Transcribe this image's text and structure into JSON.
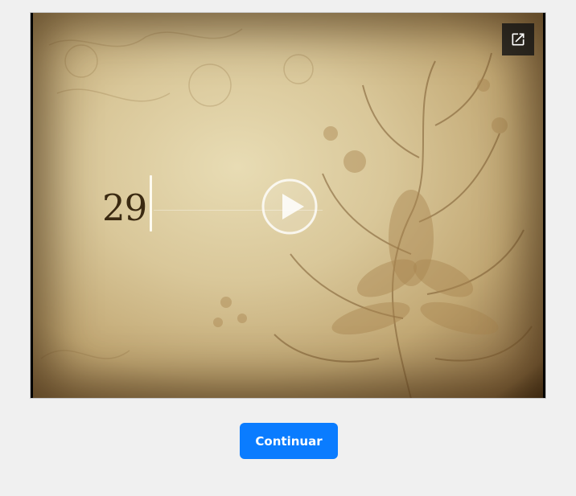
{
  "video": {
    "overlay_number": "29",
    "play_icon": "play-icon",
    "open_external_icon": "open-in-new-icon"
  },
  "actions": {
    "continue_label": "Continuar"
  },
  "colors": {
    "primary_button": "#0a7cff",
    "page_background": "#f0f0f0",
    "overlay_button": "#141414"
  }
}
